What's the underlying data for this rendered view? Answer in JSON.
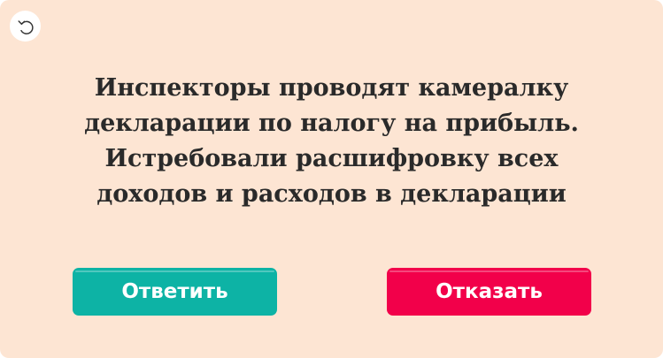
{
  "icons": {
    "back": "undo-arrow-icon"
  },
  "colors": {
    "background": "#fde5d3",
    "answer_button": "#0db3a5",
    "decline_button": "#f2004a",
    "text": "#2a2a2a"
  },
  "message": {
    "lines": [
      "Инспекторы проводят камералку",
      "декларации по налогу на прибыль.",
      "Истребовали расшифровку всех",
      "доходов и расходов в декларации"
    ]
  },
  "buttons": {
    "answer_label": "Ответить",
    "decline_label": "Отказать"
  }
}
